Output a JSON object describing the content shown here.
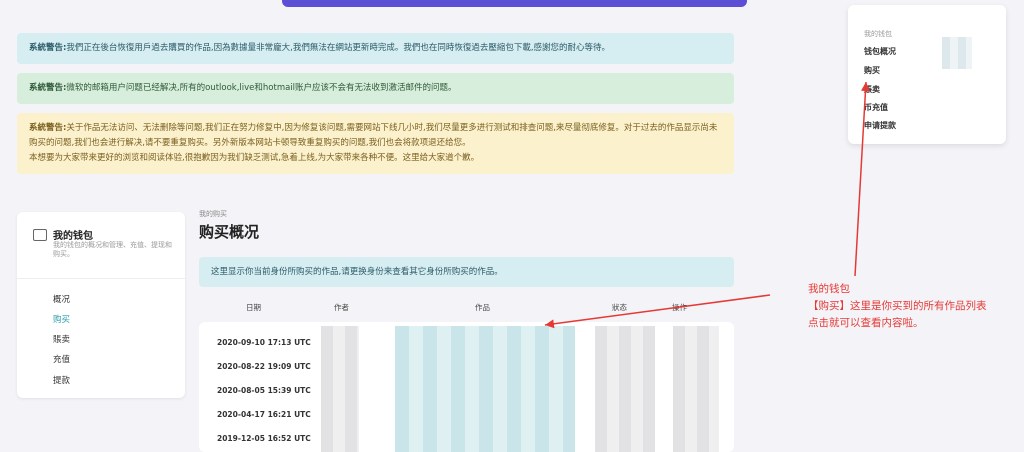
{
  "alerts": [
    {
      "label": "系統警告:",
      "text": "我們正在後台恢復用戶過去購買的作品,因為數據量非常龐大,我們無法在網站更新時完成。我們也在同時恢復過去壓縮包下載,感謝您的耐心等待。"
    },
    {
      "label": "系統警告:",
      "text": "微软的邮箱用户问题已经解决,所有的outlook,live和hotmail账户应该不会有无法收到激活邮件的问题。"
    },
    {
      "label": "系統警告:",
      "text": "关于作品无法访问、无法删除等问题,我们正在努力修复中,因为修复该问题,需要网站下线几小时,我们尽量更多进行测试和排查问题,来尽量彻底修复。对于过去的作品显示尚未购买的问题,我们也会进行解决,请不要重复购买。另外新版本网站卡顿导致重复购买的问题,我们也会将款项退还给您。",
      "text2": "本想要为大家带来更好的浏览和阅读体验,很抱歉因为我们缺乏测试,急着上线,为大家带来各种不便。这里给大家道个歉。"
    }
  ],
  "wallet": {
    "title": "我的钱包",
    "description": "我的钱包的概况和管理、充值、提现和购买。",
    "nav": [
      "概况",
      "购买",
      "賬卖",
      "充值",
      "提款"
    ]
  },
  "main": {
    "breadcrumb": "我的购买",
    "title": "购买概况",
    "notice": "这里显示你当前身份所购买的作品,请更换身份来查看其它身份所购买的作品。",
    "columns": [
      "日期",
      "作者",
      "作品",
      "狀态",
      "操作"
    ],
    "rows": [
      "2020-09-10 17:13 UTC",
      "2020-08-22 19:09 UTC",
      "2020-08-05 15:39 UTC",
      "2020-04-17 16:21 UTC",
      "2019-12-05 16:52 UTC"
    ]
  },
  "menu": {
    "heading": "我的钱包",
    "items": [
      "钱包概况",
      "购买",
      "賬卖",
      "币充值",
      "申请提款"
    ]
  },
  "annotation": {
    "lines": [
      "我的钱包",
      "【购买】这里是你买到的所有作品列表",
      "点击就可以查看内容啦。"
    ],
    "color": "#e53935"
  }
}
